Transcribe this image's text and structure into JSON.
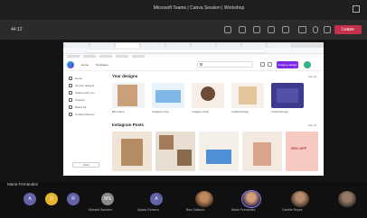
{
  "meeting": {
    "window_title": "Microsoft Teams | Canva Session | Workshop",
    "elapsed": "44:12",
    "leave_label": "Leave"
  },
  "canva": {
    "nav": [
      "Home",
      "Templates"
    ],
    "search_placeholder": "Search your content",
    "create_label": "Create a design",
    "sidebar": [
      "Home",
      "All your designs",
      "Shared with you",
      "Projects",
      "Brand Kit",
      "Content Planner"
    ],
    "trash_label": "Trash",
    "designs_title": "Your designs",
    "designs_seeall": "See all",
    "designs": [
      {
        "caption": "Blue Wave"
      },
      {
        "caption": "Instagram Post"
      },
      {
        "caption": "Instagram Post"
      },
      {
        "caption": "Untitled Design"
      },
      {
        "caption": "Untitled Design"
      }
    ],
    "posts_title": "Instagram Posts",
    "posts_seeall": "See all",
    "post_badge": "35% OFF"
  },
  "participants": {
    "presenter": "Maria Fernandez",
    "people": [
      {
        "initials": "A",
        "name": "",
        "color": "#6264a7"
      },
      {
        "initials": "D",
        "name": "",
        "color": "#e8b42e"
      },
      {
        "initials": "R",
        "name": "",
        "color": "#6264a7"
      },
      {
        "initials": "MS",
        "name": "Michael Sanders",
        "color": "#8a8a8a"
      },
      {
        "initials": "A",
        "name": "Alyssa Romero",
        "color": "#6264a7"
      },
      {
        "initials": "",
        "name": "Bea Gallardo",
        "color": "#5a3a2a"
      },
      {
        "initials": "",
        "name": "Maria Fernandez",
        "color": "#3a2a4a"
      },
      {
        "initials": "",
        "name": "Camille Reyes",
        "color": "#4a3a30"
      },
      {
        "initials": "",
        "name": "",
        "color": "#3a3a3a"
      }
    ]
  }
}
